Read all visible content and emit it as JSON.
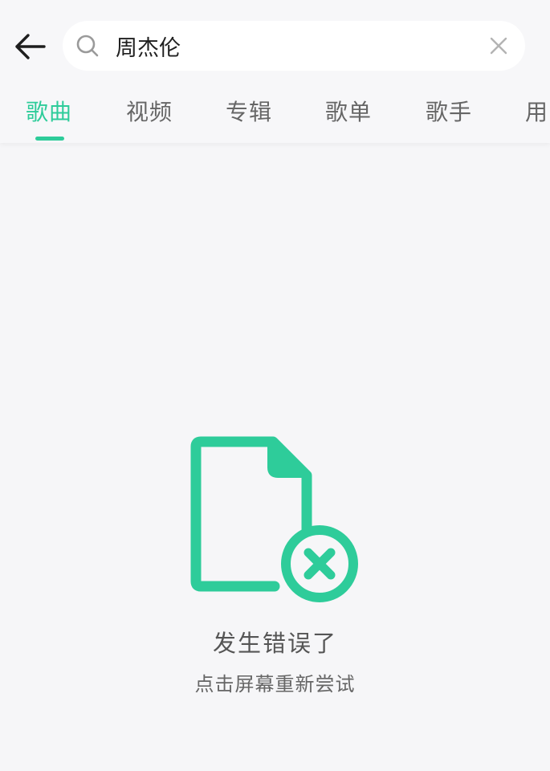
{
  "header": {
    "search": {
      "query": "周杰伦"
    },
    "tabs": [
      {
        "label": "歌曲",
        "active": true
      },
      {
        "label": "视频",
        "active": false
      },
      {
        "label": "专辑",
        "active": false
      },
      {
        "label": "歌单",
        "active": false
      },
      {
        "label": "歌手",
        "active": false
      },
      {
        "label": "用",
        "active": false
      }
    ]
  },
  "error": {
    "title": "发生错误了",
    "subtitle": "点击屏幕重新尝试"
  },
  "colors": {
    "accent": "#2ecc9a",
    "background": "#f6f6f8"
  },
  "icons": {
    "back": "arrow-left-icon",
    "search": "search-icon",
    "clear": "close-icon",
    "error": "file-error-icon"
  }
}
